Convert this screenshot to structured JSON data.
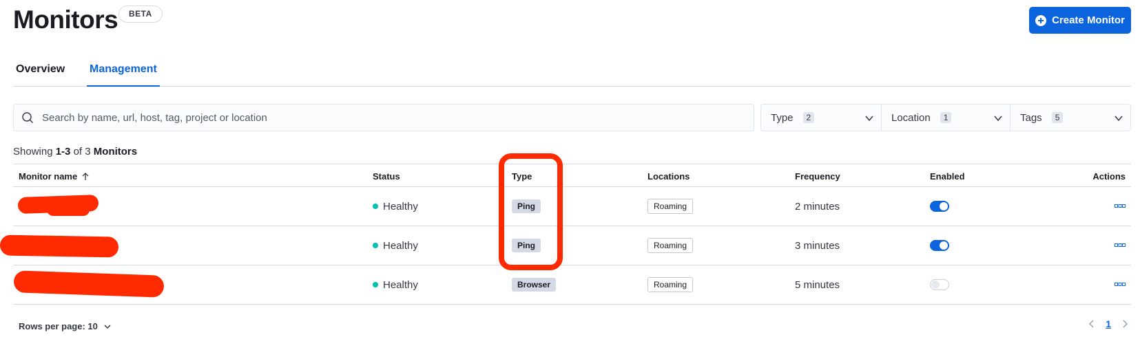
{
  "header": {
    "title": "Monitors",
    "badge": "BETA",
    "create_button": "Create Monitor"
  },
  "tabs": [
    {
      "label": "Overview",
      "active": false
    },
    {
      "label": "Management",
      "active": true
    }
  ],
  "search": {
    "placeholder": "Search by name, url, host, tag, project or location",
    "value": ""
  },
  "filters": [
    {
      "label": "Type",
      "count": "2"
    },
    {
      "label": "Location",
      "count": "1"
    },
    {
      "label": "Tags",
      "count": "5"
    }
  ],
  "summary": {
    "prefix": "Showing",
    "range": "1-3",
    "of": "of 3",
    "noun": "Monitors"
  },
  "table": {
    "columns": [
      "Monitor name",
      "Status",
      "Type",
      "Locations",
      "Frequency",
      "Enabled",
      "Actions"
    ],
    "sort_indicator": "arrow-up-icon",
    "rows": [
      {
        "name": "",
        "status": "Healthy",
        "type": "Ping",
        "location": "Roaming",
        "frequency": "2 minutes",
        "enabled": true
      },
      {
        "name": "",
        "status": "Healthy",
        "type": "Ping",
        "location": "Roaming",
        "frequency": "3 minutes",
        "enabled": true
      },
      {
        "name": "",
        "status": "Healthy",
        "type": "Browser",
        "location": "Roaming",
        "frequency": "5 minutes",
        "enabled": false
      }
    ]
  },
  "footer": {
    "rows_per_page": "Rows per page: 10",
    "current_page": "1"
  },
  "colors": {
    "accent": "#0b64dd",
    "healthy": "#00bfb3",
    "annotation": "#ff2a00"
  }
}
